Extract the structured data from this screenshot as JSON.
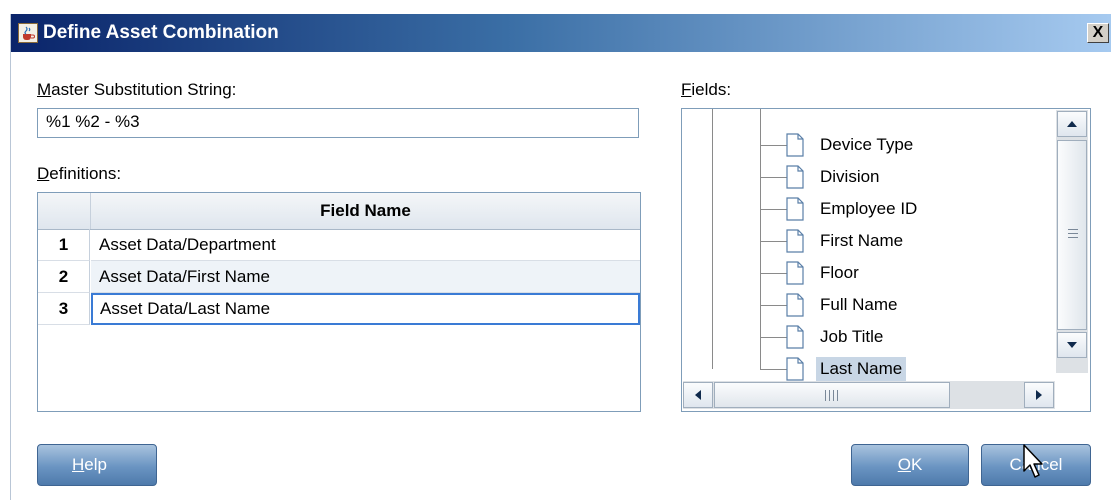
{
  "window": {
    "title": "Define Asset Combination",
    "close_glyph": "X"
  },
  "master": {
    "label_mnemonic": "M",
    "label_rest": "aster Substitution String:",
    "value": "%1 %2 - %3"
  },
  "definitions": {
    "label_mnemonic": "D",
    "label_rest": "efinitions:",
    "column_header": "Field Name",
    "rows": [
      {
        "index": "1",
        "field": "Asset Data/Department"
      },
      {
        "index": "2",
        "field": "Asset Data/First Name"
      },
      {
        "index": "3",
        "field": "Asset Data/Last Name"
      }
    ]
  },
  "fields": {
    "label_mnemonic": "F",
    "label_rest": "ields:",
    "items": [
      "Device Type",
      "Division",
      "Employee ID",
      "First Name",
      "Floor",
      "Full Name",
      "Job Title",
      "Last Name"
    ],
    "selected_item": "Last Name"
  },
  "buttons": {
    "help_mnemonic": "H",
    "help_rest": "elp",
    "ok_mnemonic": "O",
    "ok_rest": "K",
    "cancel_label": "Cancel"
  },
  "colors": {
    "title_bar_start": "#0a246a",
    "title_bar_end": "#a6caf0",
    "button_blue": "#6a94c2",
    "selection_border": "#3a7bd5",
    "tree_selection": "#c8d6e5"
  },
  "icons": {
    "title": "java-cup-icon",
    "close": "close-icon",
    "tree_item": "document-icon",
    "scroll_up": "arrow-up-icon",
    "scroll_down": "arrow-down-icon",
    "scroll_left": "arrow-left-icon",
    "scroll_right": "arrow-right-icon",
    "cursor": "mouse-pointer-icon"
  }
}
